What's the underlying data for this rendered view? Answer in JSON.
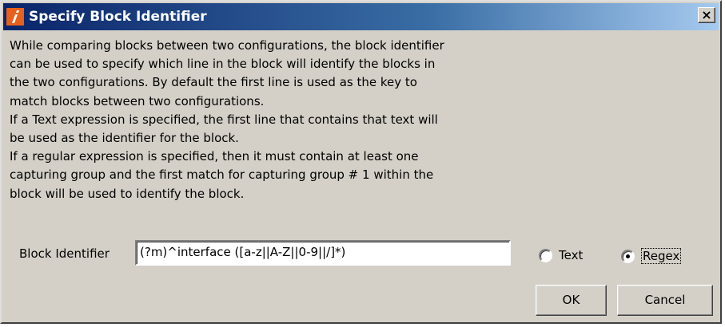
{
  "dialog": {
    "title": "Specify Block Identifier",
    "close_label": "×",
    "description_lines": [
      "While comparing blocks between two configurations, the block identifier",
      "can be used to specify which line in the block will identify the blocks in",
      "the two configurations. By default the first line is used as the key to",
      "match blocks between two configurations.",
      "If a Text expression is specified, the first line that contains that text will",
      "be used as the identifier for the block.",
      "If a regular expression is specified, then it must contain at least one",
      "capturing group and the first match for capturing group # 1 within the",
      "block will be used to identify the block."
    ],
    "field": {
      "label": "Block Identifier",
      "value": "(?m)^interface ([a-z||A-Z||0-9||/]*)"
    },
    "options": {
      "text_label": "Text",
      "regex_label": "Regex",
      "selected": "Regex"
    },
    "buttons": {
      "ok": "OK",
      "cancel": "Cancel"
    }
  }
}
